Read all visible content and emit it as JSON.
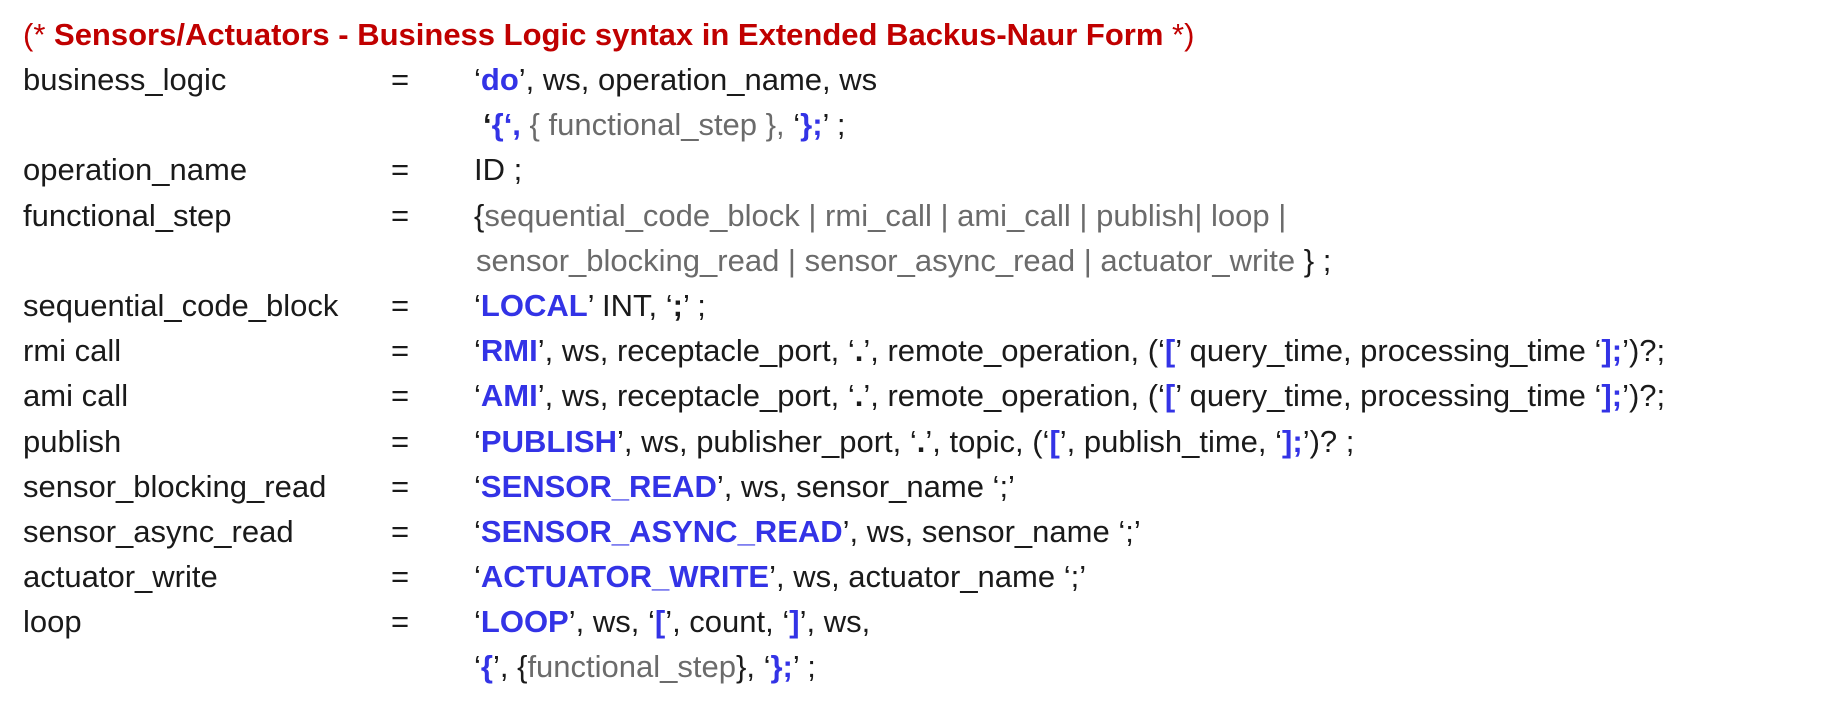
{
  "title": {
    "open": "(*",
    "text": "Sensors/Actuators - Business Logic syntax in Extended Backus-Naur Form",
    "close": "*)"
  },
  "eq": "=",
  "rules": {
    "business_logic": {
      "name": "business_logic",
      "l1": [
        "‘",
        "do",
        "’, ws, operation_name, ws"
      ],
      "l2": [
        "‘",
        "{‘,",
        " { functional_step }, ",
        "‘",
        "};",
        "’ ;"
      ]
    },
    "operation_name": {
      "name": "operation_name",
      "rhs": "ID ;"
    },
    "functional_step": {
      "name": "functional_step",
      "l1": [
        "{",
        "sequential_code_block | rmi_call | ami_call | publish| loop |"
      ],
      "l2": [
        "sensor_blocking_read | sensor_async_read | actuator_write",
        " } ;"
      ]
    },
    "sequential_code_block": {
      "name": "sequential_code_block",
      "parts": [
        "‘",
        "LOCAL",
        "’ INT, ‘",
        ";",
        "’ ;"
      ]
    },
    "rmi_call": {
      "name": "rmi call",
      "parts": [
        "‘",
        "RMI",
        "’, ws, receptacle_port, ‘",
        ".",
        "’, remote_operation, (‘",
        "[",
        "’ query_time, processing_time ‘",
        "];",
        "’)?;"
      ]
    },
    "ami_call": {
      "name": "ami call",
      "parts": [
        "‘",
        "AMI",
        "’, ws, receptacle_port, ‘",
        ".",
        "’, remote_operation, (‘",
        "[",
        "’ query_time, processing_time ‘",
        "];",
        "’)?;"
      ]
    },
    "publish": {
      "name": "publish",
      "parts": [
        "‘",
        "PUBLISH",
        "’, ws, publisher_port, ‘",
        ".",
        "’, topic, (‘",
        "[",
        "’, publish_time, ‘",
        "];",
        "’)? ;"
      ]
    },
    "sensor_blocking_read": {
      "name": "sensor_blocking_read",
      "parts": [
        "‘",
        "SENSOR_READ",
        "’, ws, sensor_name ‘;’"
      ]
    },
    "sensor_async_read": {
      "name": "sensor_async_read",
      "parts": [
        "‘",
        "SENSOR_ASYNC_READ",
        "’, ws, sensor_name ‘;’"
      ]
    },
    "actuator_write": {
      "name": "actuator_write",
      "parts": [
        "‘",
        "ACTUATOR_WRITE",
        "’, ws, actuator_name ‘;’"
      ]
    },
    "loop": {
      "name": "loop",
      "l1": [
        "‘",
        "LOOP",
        "’, ws, ‘",
        "[",
        "’, count, ‘",
        "]",
        "’, ws,"
      ],
      "l2": [
        "‘",
        "{",
        "’, {",
        "functional_step",
        "}, ‘",
        "};",
        "’ ;"
      ]
    }
  }
}
